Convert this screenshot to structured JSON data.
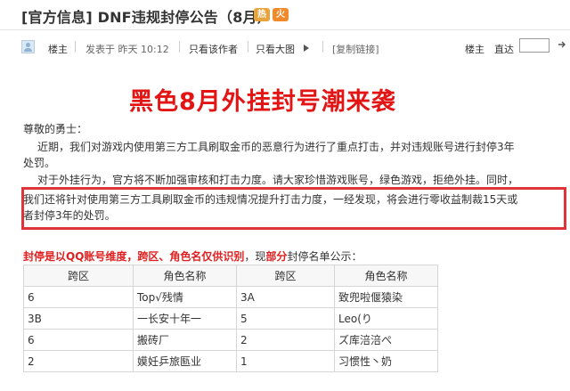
{
  "post": {
    "title": "[官方信息] DNF违规封停公告（8月）",
    "badges": [
      "热",
      "火"
    ]
  },
  "meta": {
    "author_role": "楼主",
    "posted": "发表于 昨天 10:12",
    "only_author": "只看该作者",
    "only_image": "只看大图",
    "copy_link": "[复制链接]",
    "floor_label": "楼主",
    "jump_label": "直达",
    "jump_value": ""
  },
  "content": {
    "headline": "黑色8月外挂封号潮来袭",
    "greeting": "尊敬的勇士：",
    "para1_line1": "近期，我们对游戏内使用第三方工具刷取金币的恶意行为进行了重点打击，并对违规账号进行封停3年",
    "para1_line2": "处罚。",
    "para2_line1": "对于外挂行为，官方将不断加强审核和打击力度。请大家珍惜游戏账号，绿色游戏，拒绝外挂。同时，",
    "para3_line1": "我们还将针对使用第三方工具刷取金币的违规情况提升打击力度，一经发现，将会进行零收益制裁15天或",
    "para3_line2": "者封停3年的处罚。",
    "notice_part1": "封停是以QQ账号维度，跨区、角色名仅供识别",
    "notice_part2": "，现",
    "notice_part3": "部分",
    "notice_part4": "封停名单公示："
  },
  "table": {
    "headers": [
      "跨区",
      "角色名称",
      "跨区",
      "角色名称"
    ],
    "rows": [
      [
        "6",
        "Top√残情",
        "3A",
        "致兜啦偃猿染"
      ],
      [
        "3B",
        "一长安十年一",
        "5",
        "Leo(り"
      ],
      [
        "6",
        "搬砖厂",
        "2",
        "ズ库涪涪ぺ"
      ],
      [
        "2",
        "嫫妊乒旅匦业",
        "1",
        "习惯性丶奶"
      ]
    ]
  },
  "colors": {
    "headline": "#e31414",
    "highlight_border": "#e0343b",
    "notice_red": "#e02020"
  }
}
